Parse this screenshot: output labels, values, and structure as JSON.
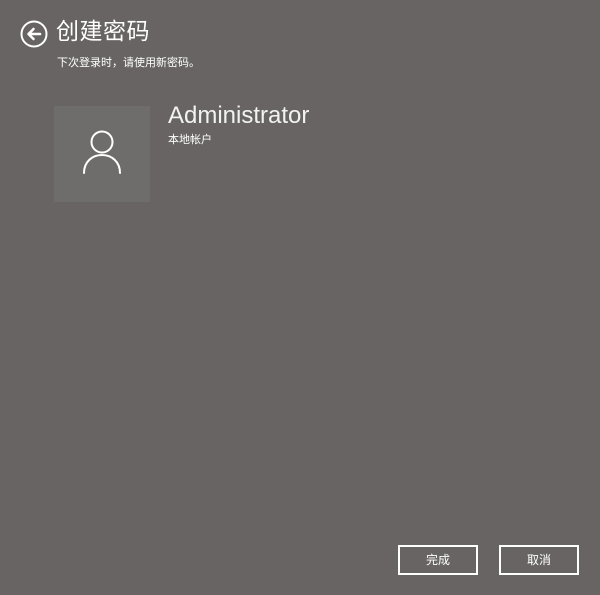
{
  "header": {
    "back_icon": "arrow-left-circle-icon",
    "title": "创建密码",
    "subtitle": "下次登录时，请使用新密码。"
  },
  "account": {
    "avatar_icon": "user-icon",
    "name": "Administrator",
    "type": "本地帐户"
  },
  "actions": {
    "finish_label": "完成",
    "cancel_label": "取消"
  },
  "colors": {
    "background": "#686464",
    "avatar_tile": "#6f6d6c",
    "foreground": "#ffffff"
  }
}
